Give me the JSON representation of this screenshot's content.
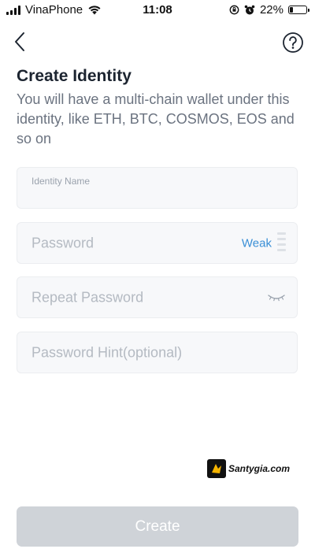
{
  "status_bar": {
    "carrier": "VinaPhone",
    "time": "11:08",
    "battery_percent": "22%",
    "battery_level": 0.22
  },
  "header": {
    "back_icon": "chevron-left-icon",
    "help_icon": "question-circle-icon"
  },
  "page": {
    "title": "Create Identity",
    "subtitle": "You will have a multi-chain wallet under this identity, like ETH, BTC, COSMOS, EOS and so on"
  },
  "form": {
    "identity_name_label": "Identity Name",
    "password_placeholder": "Password",
    "password_strength_label": "Weak",
    "repeat_password_placeholder": "Repeat Password",
    "hint_placeholder": "Password Hint(optional)"
  },
  "watermark": {
    "text": "Santygia.com"
  },
  "actions": {
    "create_label": "Create"
  },
  "colors": {
    "accent": "#3a8fd6",
    "button_disabled": "#cfd3d8",
    "field_bg": "#f7f8fa"
  }
}
